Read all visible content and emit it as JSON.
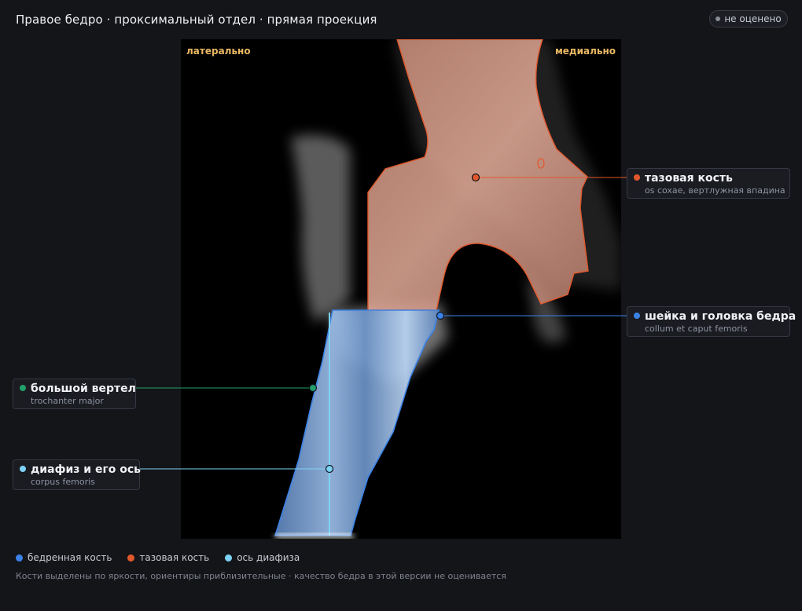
{
  "header": {
    "title": "Правое бедро · проксимальный отдел · прямая проекция",
    "status_badge": "не оценено"
  },
  "viewer": {
    "lateral_label": "латерально",
    "medial_label": "медиально"
  },
  "callouts": {
    "pelvis": {
      "title": "тазовая кость",
      "subtitle": "os coxae, вертлужная впадина",
      "color": "#e2582c"
    },
    "neck_head": {
      "title": "шейка и головка бедра",
      "subtitle": "collum et caput femoris",
      "color": "#3b82e6"
    },
    "trochanter": {
      "title": "большой вертел",
      "subtitle": "trochanter major",
      "color": "#22a06b"
    },
    "shaft": {
      "title": "диафиз и его ось",
      "subtitle": "corpus femoris",
      "color": "#7dd3f5"
    }
  },
  "legend": {
    "femur": {
      "label": "бедренная кость",
      "color": "#3b82e6"
    },
    "pelvis": {
      "label": "тазовая кость",
      "color": "#e2582c"
    },
    "axis": {
      "label": "ось диафиза",
      "color": "#7dd3f5"
    }
  },
  "footnote": "Кости выделены по яркости, ориентиры приблизительные · качество бедра в этой версии не оценивается"
}
